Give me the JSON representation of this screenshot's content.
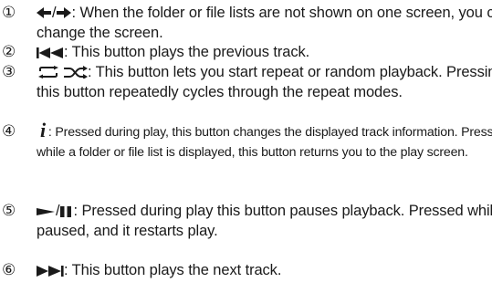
{
  "items": [
    {
      "number": "①",
      "icons": [
        "left-arrow-icon",
        "right-arrow-icon"
      ],
      "separator": "/",
      "text": ": When the folder or file lists are not shown on one screen, you can change the screen."
    },
    {
      "number": "②",
      "icons": [
        "previous-track-icon"
      ],
      "text": ": This button plays the previous track."
    },
    {
      "number": "③",
      "icons": [
        "repeat-icon",
        "shuffle-icon"
      ],
      "text": ": This button lets you start repeat or random playback. Pressing this button repeatedly cycles through the repeat modes."
    },
    {
      "number": "④",
      "icon_glyph": "i",
      "icons": [
        "info-icon"
      ],
      "text": ": Pressed during play, this button changes the displayed track information. Pressed while a folder or file list is displayed, this button returns you to the play screen."
    },
    {
      "number": "⑤",
      "icons": [
        "play-icon",
        "pause-icon"
      ],
      "separator": "/",
      "text": ": Pressed during play this button pauses playback. Pressed while paused, and it restarts play."
    },
    {
      "number": "⑥",
      "icons": [
        "next-track-icon"
      ],
      "text": ": This button plays the next track."
    }
  ]
}
